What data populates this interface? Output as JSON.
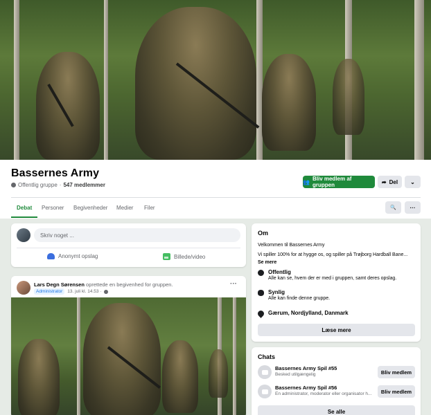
{
  "group": {
    "name": "Bassernes Army",
    "privacy": "Offentlig gruppe",
    "separator": "·",
    "members": "547 medlemmer"
  },
  "actions": {
    "join": "Bliv medlem af gruppen",
    "share": "Del",
    "more": "⌄"
  },
  "tabs": [
    "Debat",
    "Personer",
    "Begivenheder",
    "Medier",
    "Filer"
  ],
  "tab_buttons": {
    "search": "🔍",
    "more": "···"
  },
  "composer": {
    "placeholder": "Skriv noget ...",
    "anon": "Anonymt opslag",
    "photo": "Billede/video"
  },
  "post": {
    "author": "Lars Degn Sørensen",
    "action": " oprettede en begivenhed for gruppen.",
    "role": "Administrator",
    "time": "13. juli kl. 14.53 ·",
    "more": "···"
  },
  "about": {
    "title": "Om",
    "welcome": "Velkommen til Bassernes Army",
    "description": "Vi spiller 100% for at hygge os, og spiller på Trøjborg Hardball Bane...",
    "see_more": " Se mere",
    "items": [
      {
        "icon": "globe-icon",
        "title": "Offentlig",
        "desc": "Alle kan se, hvem der er med i gruppen, samt deres opslag."
      },
      {
        "icon": "eye-icon",
        "title": "Synlig",
        "desc": "Alle kan finde denne gruppe."
      },
      {
        "icon": "location-pin-icon",
        "title": "Gærum, Nordjylland, Danmark",
        "desc": ""
      }
    ],
    "read_more": "Læse mere"
  },
  "chats": {
    "title": "Chats",
    "items": [
      {
        "name": "Bassernes Army Spil #55",
        "desc": "Besked utilgængelig",
        "button": "Bliv medlem"
      },
      {
        "name": "Bassernes Army Spil #56",
        "desc": "En administrator, moderator eller organisator h...",
        "button": "Bliv medlem"
      }
    ],
    "see_all": "Se alle"
  },
  "colors": {
    "accent": "#1f8a3b",
    "page_bg": "#e6ebe6",
    "button_bg": "#e4e6eb"
  }
}
